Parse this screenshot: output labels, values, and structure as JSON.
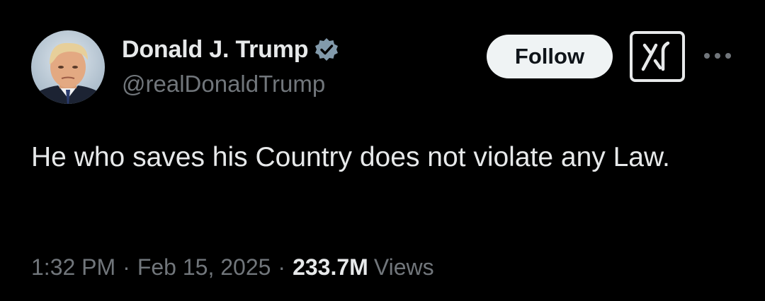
{
  "user": {
    "display_name": "Donald J. Trump",
    "handle": "@realDonaldTrump",
    "verified": true
  },
  "actions": {
    "follow_label": "Follow",
    "grok_icon": "grok-icon",
    "more_icon": "more-icon"
  },
  "tweet": {
    "text": "He who saves his Country does not violate any Law."
  },
  "meta": {
    "time": "1:32 PM",
    "separator": "·",
    "date": "Feb 15, 2025",
    "views_count": "233.7M",
    "views_label": "Views"
  },
  "colors": {
    "background": "#000000",
    "primary_text": "#e7e9ea",
    "secondary_text": "#71767b",
    "follow_button_bg": "#eff3f4",
    "verified_badge": "#829aab"
  }
}
